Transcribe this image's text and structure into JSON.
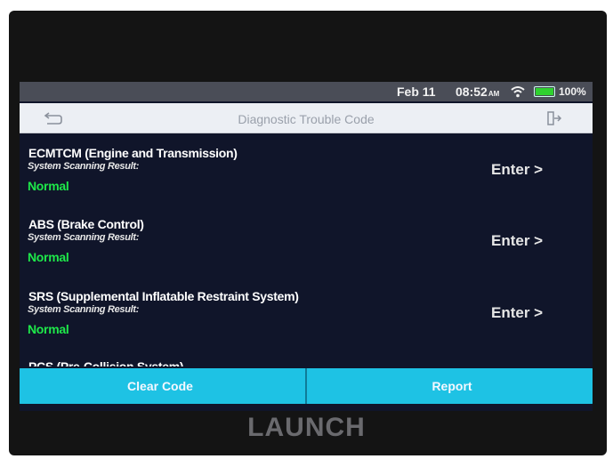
{
  "statusbar": {
    "date": "Feb 11",
    "time": "08:52",
    "ampm": "AM",
    "battery": "100%"
  },
  "titlebar": {
    "title": "Diagnostic Trouble Code"
  },
  "systems": [
    {
      "name": "ECMTCM (Engine and Transmission)",
      "scan_label": "System Scanning Result:",
      "status": "Normal",
      "enter": "Enter >"
    },
    {
      "name": "ABS (Brake Control)",
      "scan_label": "System Scanning Result:",
      "status": "Normal",
      "enter": "Enter >"
    },
    {
      "name": "SRS (Supplemental Inflatable Restraint System)",
      "scan_label": "System Scanning Result:",
      "status": "Normal",
      "enter": "Enter >"
    },
    {
      "name": "PCS (Pre-Collision System)"
    }
  ],
  "buttons": {
    "clear": "Clear Code",
    "report": "Report"
  },
  "brand": "LAUNCH",
  "colors": {
    "accent": "#1ec2e4",
    "normal": "#1ee84a",
    "screen_bg": "#10152a"
  }
}
